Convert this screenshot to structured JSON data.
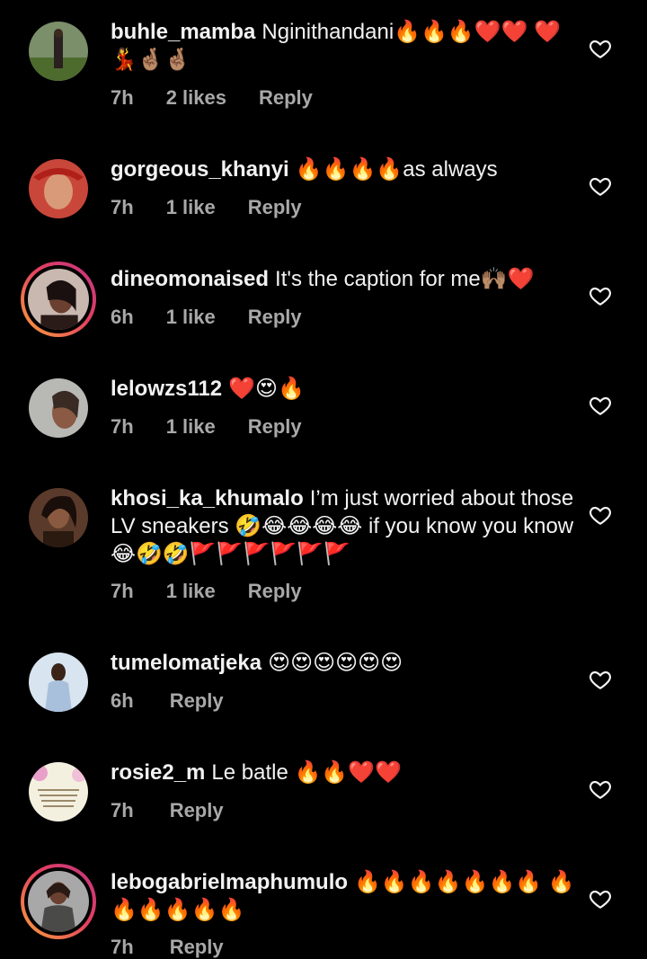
{
  "comments": [
    {
      "username": "buhle_mamba",
      "text": "Nginithandani🔥🔥🔥❤️❤️ ❤️💃🤞🏽🤞🏽",
      "time": "7h",
      "likes": "2 likes",
      "reply": "Reply"
    },
    {
      "username": "gorgeous_khanyi",
      "text": "🔥🔥🔥🔥as always",
      "time": "7h",
      "likes": "1 like",
      "reply": "Reply"
    },
    {
      "username": "dineomonaised",
      "text": "It's the caption for me🙌🏽❤️",
      "time": "6h",
      "likes": "1 like",
      "reply": "Reply"
    },
    {
      "username": "lelowzs112",
      "text": "❤️😍🔥",
      "time": "7h",
      "likes": "1 like",
      "reply": "Reply"
    },
    {
      "username": "khosi_ka_khumalo",
      "text": "I’m just worried about those LV sneakers 🤣😂😂😂😂 if you know you know 😂🤣🤣🚩🚩🚩🚩🚩🚩",
      "time": "7h",
      "likes": "1 like",
      "reply": "Reply"
    },
    {
      "username": "tumelomatjeka",
      "text": "😍😍😍😍😍😍",
      "time": "6h",
      "likes": "",
      "reply": "Reply"
    },
    {
      "username": "rosie2_m",
      "text": "Le batle 🔥🔥❤️❤️",
      "time": "7h",
      "likes": "",
      "reply": "Reply"
    },
    {
      "username": "lebogabrielmaphumulo",
      "text": "🔥🔥🔥🔥🔥🔥🔥 🔥🔥🔥🔥🔥🔥",
      "time": "7h",
      "likes": "",
      "reply": "Reply"
    }
  ],
  "icons": {
    "like": "heart-outline-icon"
  },
  "colors": {
    "background": "#000000",
    "meta": "#a8a8a8",
    "story_ring": "#e4405f"
  }
}
